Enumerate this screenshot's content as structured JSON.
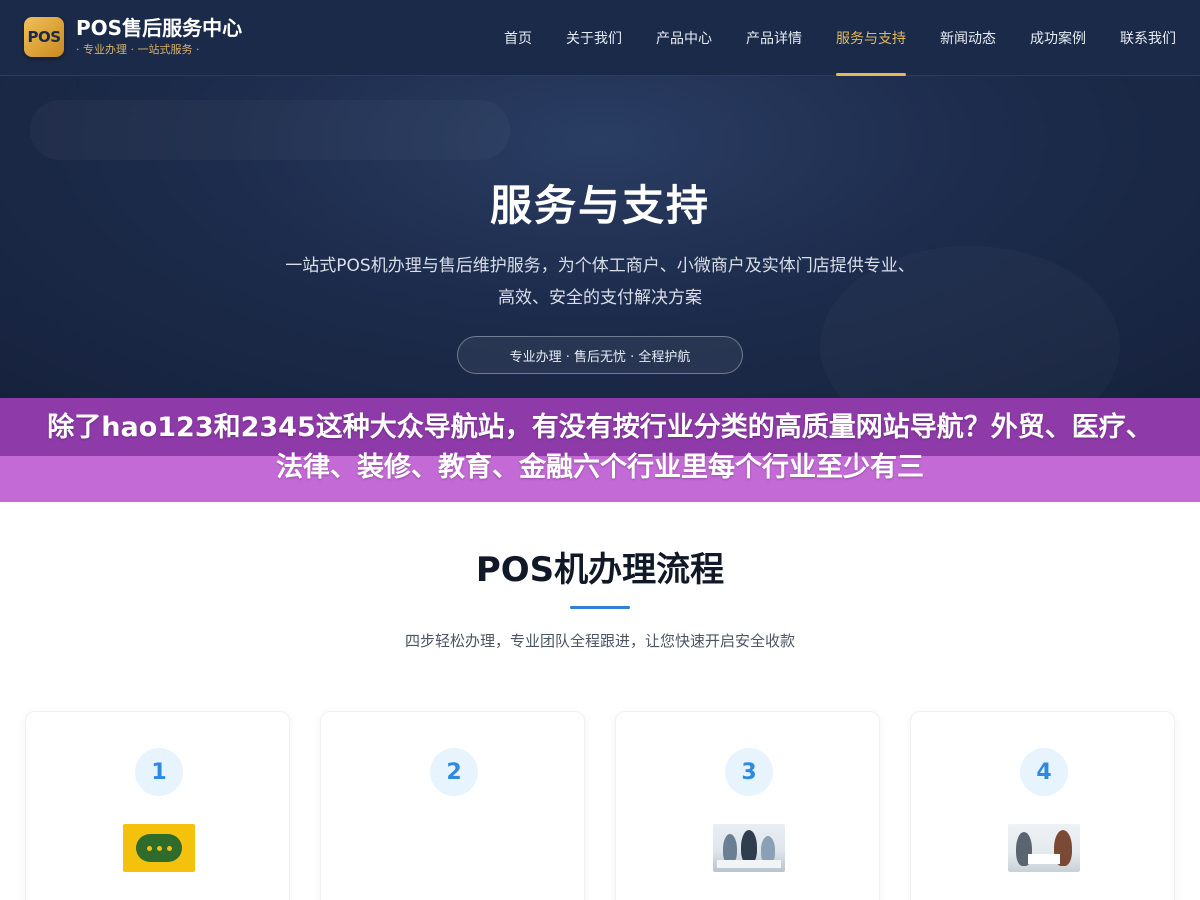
{
  "header": {
    "logo_badge": "POS",
    "logo_title": "POS售后服务中心",
    "logo_subtitle": "· 专业办理 · 一站式服务 ·",
    "nav": [
      {
        "label": "首页",
        "active": false
      },
      {
        "label": "关于我们",
        "active": false
      },
      {
        "label": "产品中心",
        "active": false
      },
      {
        "label": "产品详情",
        "active": false
      },
      {
        "label": "服务与支持",
        "active": true
      },
      {
        "label": "新闻动态",
        "active": false
      },
      {
        "label": "成功案例",
        "active": false
      },
      {
        "label": "联系我们",
        "active": false
      }
    ]
  },
  "hero": {
    "title": "服务与支持",
    "description": "一站式POS机办理与售后维护服务，为个体工商户、小微商户及实体门店提供专业、高效、安全的支付解决方案",
    "pill": "专业办理 · 售后无忧 · 全程护航"
  },
  "banner": {
    "text": "除了hao123和2345这种大众导航站，有没有按行业分类的高质量网站导航？外贸、医疗、法律、装修、教育、金融六个行业里每个行业至少有三"
  },
  "process": {
    "title": "POS机办理流程",
    "subtitle": "四步轻松办理，专业团队全程跟进，让您快速开启安全收款",
    "steps": [
      {
        "number": "1",
        "image": "chat-bubble-image"
      },
      {
        "number": "2",
        "image": ""
      },
      {
        "number": "3",
        "image": "office-team-image"
      },
      {
        "number": "4",
        "image": "consultation-image"
      }
    ]
  },
  "colors": {
    "header_bg": "#1a2a48",
    "accent_gold": "#e3b95c",
    "banner_purple": "#8f3aa9",
    "step_blue": "#2d8ae0"
  }
}
